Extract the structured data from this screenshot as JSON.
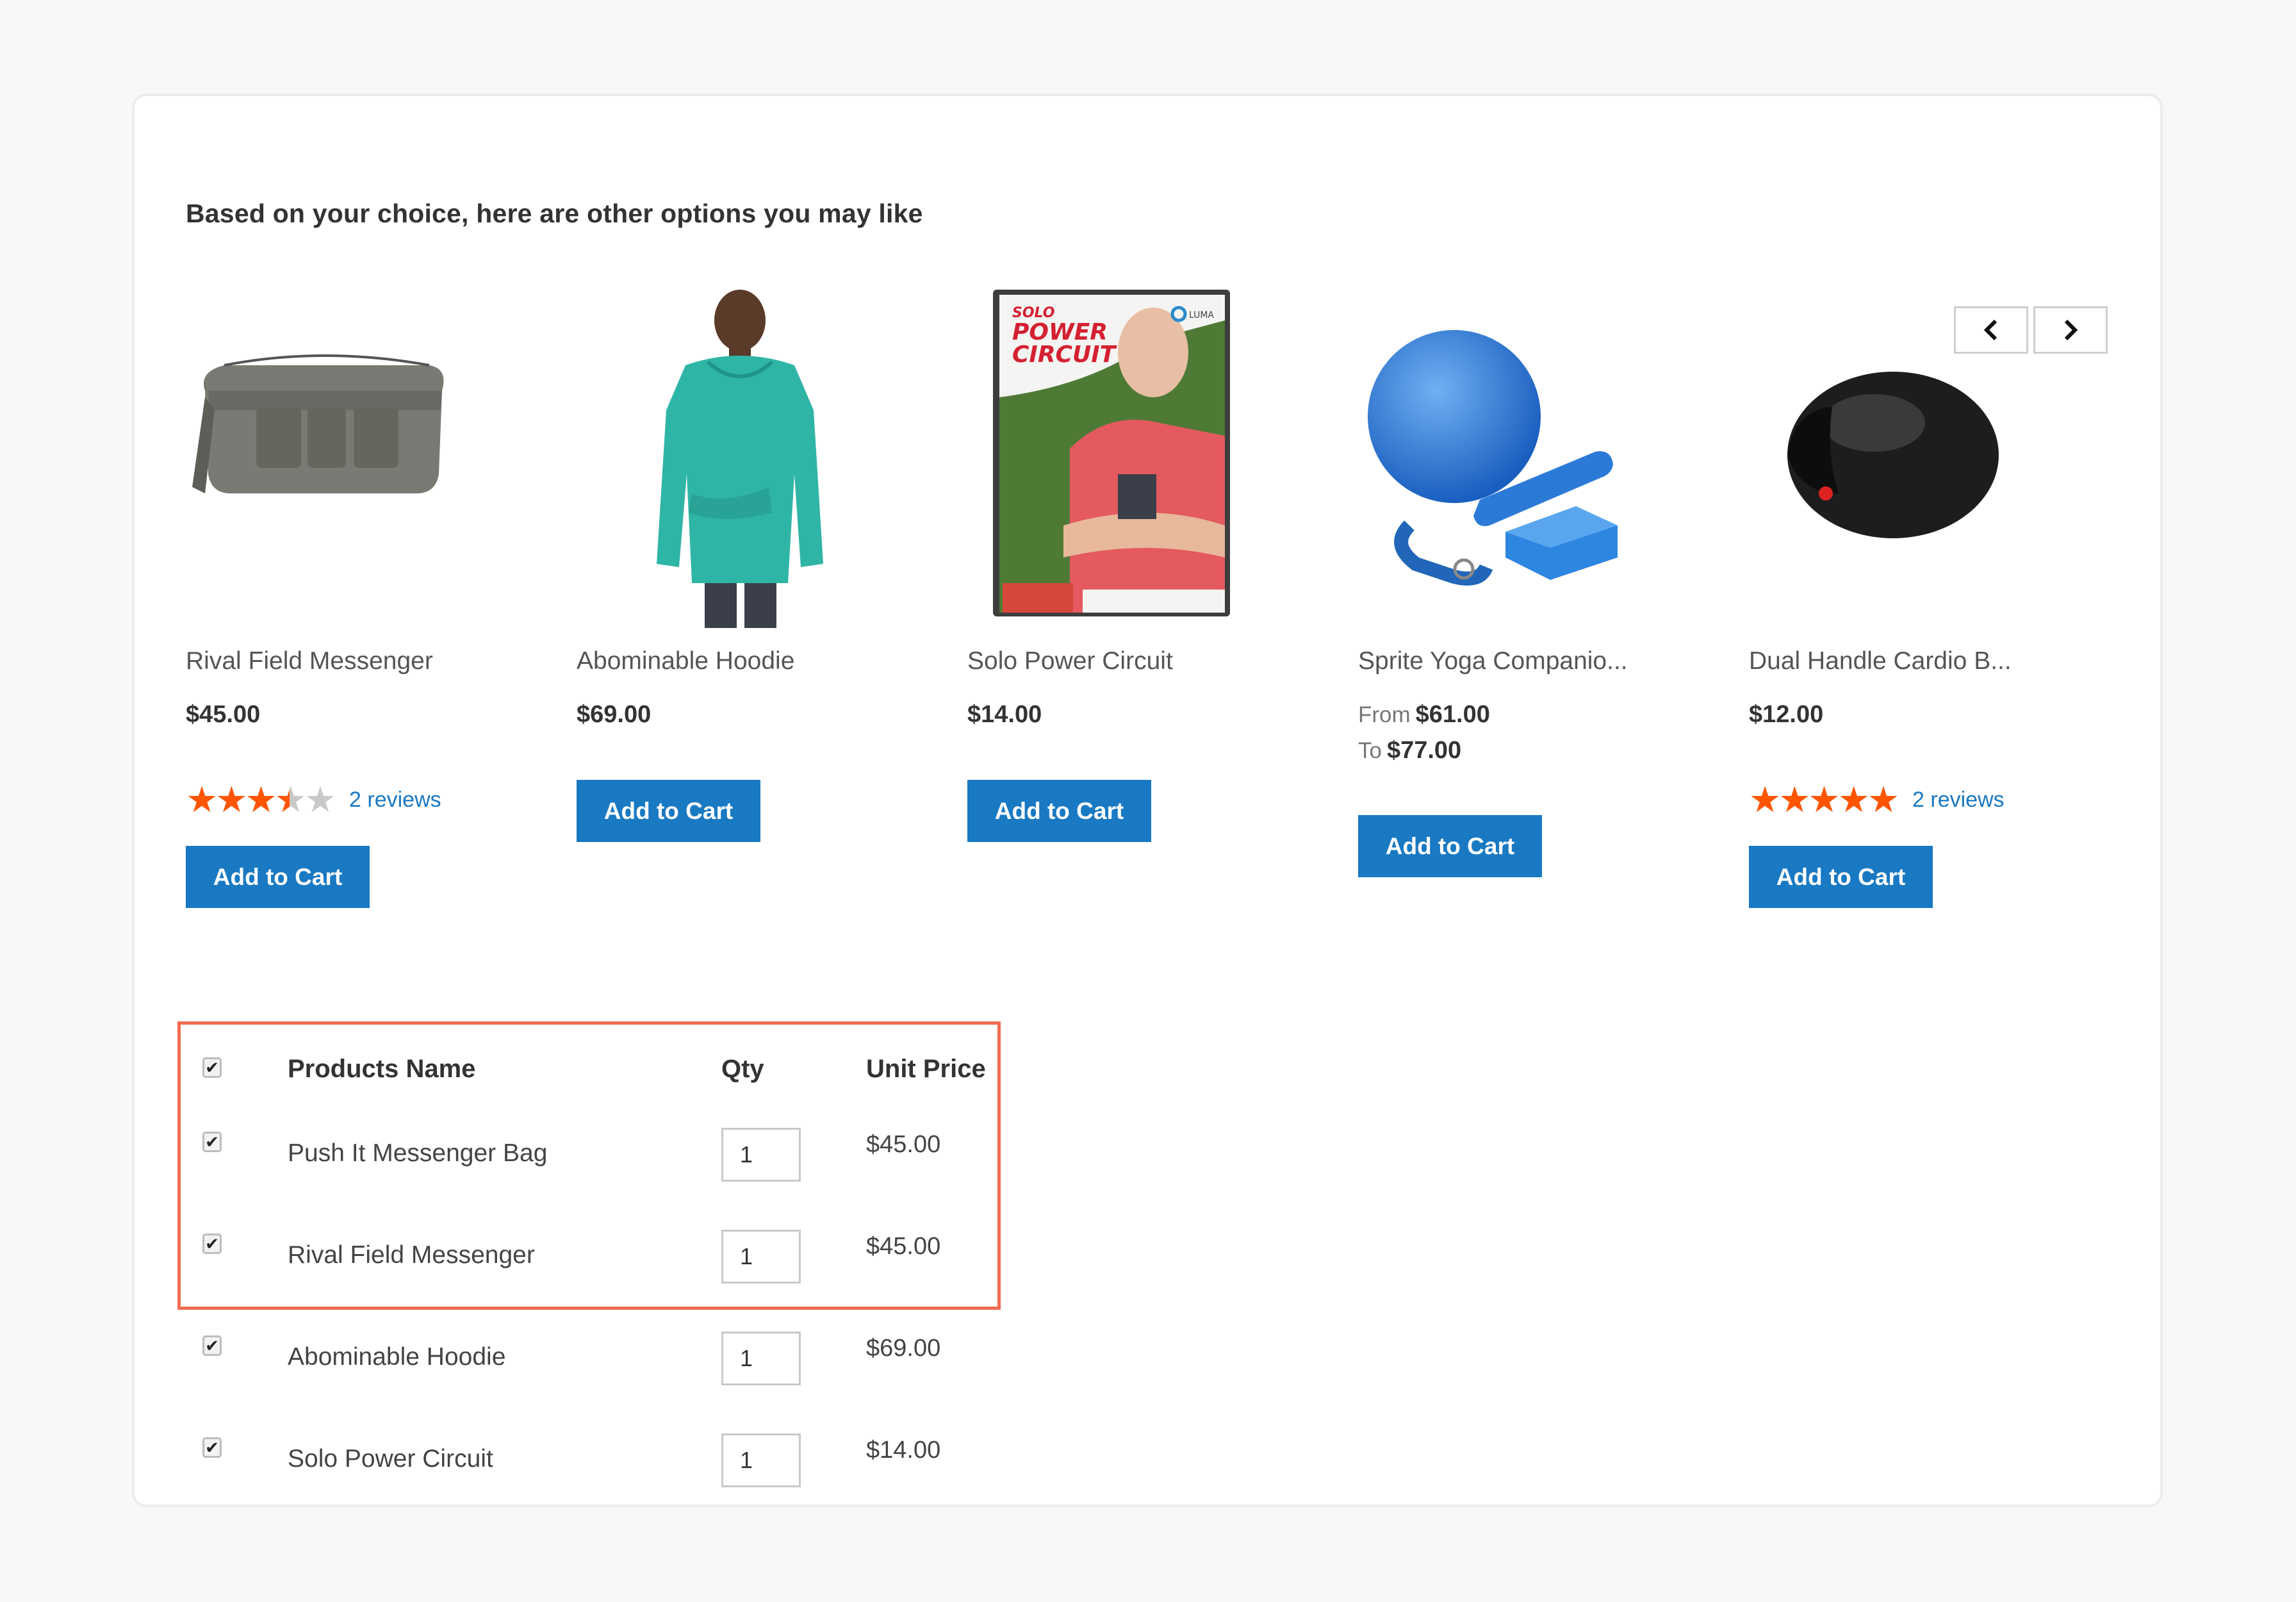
{
  "section": {
    "heading": "Based on your choice, here are other options you may like"
  },
  "carousel": {
    "prev_icon": "chevron-left-icon",
    "next_icon": "chevron-right-icon"
  },
  "products": [
    {
      "name": "Rival Field Messenger",
      "price": "$45.00",
      "rating_percent": 70,
      "reviews": "2 reviews",
      "button": "Add to Cart",
      "image": "messenger-bag-image"
    },
    {
      "name": "Abominable Hoodie",
      "price": "$69.00",
      "button": "Add to Cart",
      "image": "hoodie-image"
    },
    {
      "name": "Solo Power Circuit",
      "price": "$14.00",
      "button": "Add to Cart",
      "image": "dvd-image",
      "cover": {
        "line1": "SOLO",
        "line2": "POWER",
        "line3": "CIRCUIT",
        "brand": "LUMA"
      }
    },
    {
      "name": "Sprite Yoga Companio...",
      "price_from_label": "From",
      "price_from": "$61.00",
      "price_to_label": "To",
      "price_to": "$77.00",
      "button": "Add to Cart",
      "image": "yoga-kit-image"
    },
    {
      "name": "Dual Handle Cardio B...",
      "price": "$12.00",
      "rating_percent": 100,
      "reviews": "2 reviews",
      "button": "Add to Cart",
      "image": "cardio-ball-image"
    }
  ],
  "table": {
    "headers": {
      "name": "Products Name",
      "qty": "Qty",
      "price": "Unit Price"
    },
    "select_all_checked": true,
    "rows": [
      {
        "name": "Push It Messenger Bag",
        "qty": "1",
        "price": "$45.00",
        "checked": true
      },
      {
        "name": "Rival Field Messenger",
        "qty": "1",
        "price": "$45.00",
        "checked": true
      },
      {
        "name": "Abominable Hoodie",
        "qty": "1",
        "price": "$69.00",
        "checked": true
      },
      {
        "name": "Solo Power Circuit",
        "qty": "1",
        "price": "$14.00",
        "checked": true
      }
    ]
  },
  "colors": {
    "button_blue": "#1979c3",
    "star_orange": "#ff5501",
    "highlight_border": "#f26b4f",
    "link_blue": "#1979c3"
  },
  "glyphs": {
    "stars": "★★★★★",
    "check": "✔"
  }
}
